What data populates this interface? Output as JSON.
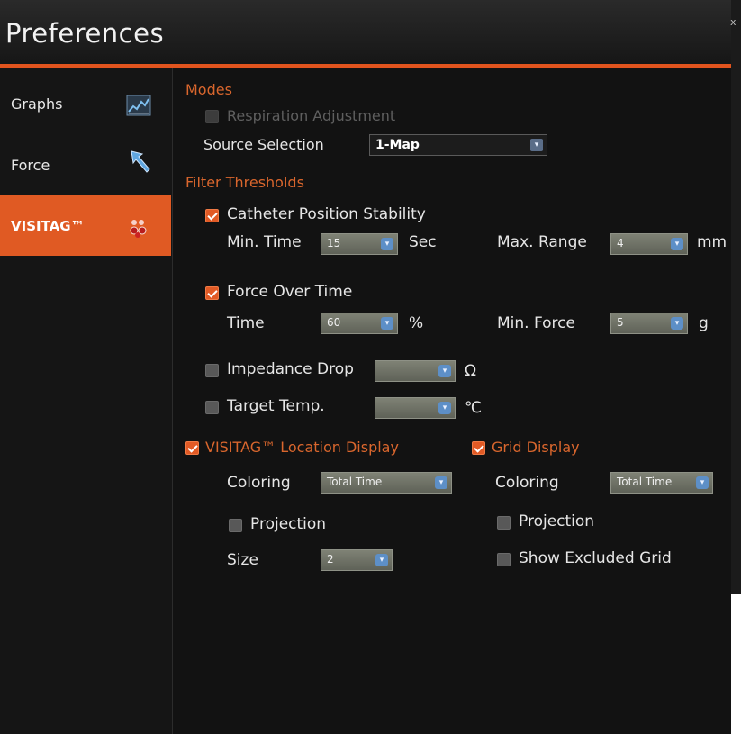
{
  "title": "Preferences",
  "close_glyph": "x",
  "colors": {
    "accent": "#e1541e",
    "active_tab": "#e05a23",
    "section_title": "#d9662d",
    "background": "#121212"
  },
  "sidebar": {
    "items": [
      {
        "label": "Graphs",
        "icon": "graph-icon",
        "active": false
      },
      {
        "label": "Force",
        "icon": "arrow-cursor-icon",
        "active": false
      },
      {
        "label": "VISITAG™",
        "icon": "visitag-dots-icon",
        "active": true
      }
    ]
  },
  "modes": {
    "title": "Modes",
    "respiration": {
      "label": "Respiration Adjustment",
      "checked": false,
      "enabled": false
    },
    "source_selection": {
      "label": "Source Selection",
      "value": "1-Map"
    }
  },
  "filter": {
    "title": "Filter Thresholds",
    "catheter": {
      "label": "Catheter Position Stability",
      "checked": true,
      "min_time_label": "Min. Time",
      "min_time_value": "15",
      "min_time_unit": "Sec",
      "max_range_label": "Max. Range",
      "max_range_value": "4",
      "max_range_unit": "mm"
    },
    "force_over_time": {
      "label": "Force Over Time",
      "checked": true,
      "time_label": "Time",
      "time_value": "60",
      "time_unit": "%",
      "min_force_label": "Min. Force",
      "min_force_value": "5",
      "min_force_unit": "g"
    },
    "impedance": {
      "label": "Impedance Drop",
      "checked": false,
      "value": "",
      "unit": "Ω"
    },
    "target_temp": {
      "label": "Target Temp.",
      "checked": false,
      "value": "",
      "unit": "℃"
    }
  },
  "visitag_display": {
    "label": "VISITAG™ Location Display",
    "checked": true,
    "coloring_label": "Coloring",
    "coloring_value": "Total Time",
    "projection_label": "Projection",
    "projection_checked": false,
    "size_label": "Size",
    "size_value": "2"
  },
  "grid_display": {
    "label": "Grid Display",
    "checked": true,
    "coloring_label": "Coloring",
    "coloring_value": "Total Time",
    "projection_label": "Projection",
    "projection_checked": false,
    "show_excluded_label": "Show Excluded Grid",
    "show_excluded_checked": false
  }
}
